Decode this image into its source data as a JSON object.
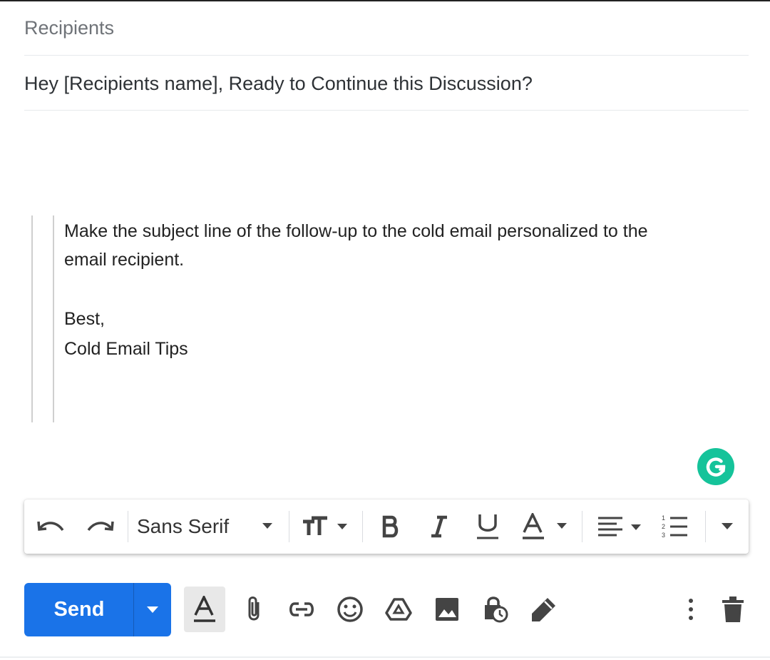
{
  "compose": {
    "recipients_label": "Recipients",
    "subject": "Hey [Recipients name], Ready to Continue this Discussion?",
    "body_line1": "Make the subject line of the follow-up to the cold email personalized to the",
    "body_line2": "email recipient.",
    "signoff": "Best,",
    "signature": "Cold Email Tips"
  },
  "format_toolbar": {
    "font_name": "Sans Serif",
    "icons": [
      "undo-icon",
      "redo-icon",
      "text-size-icon",
      "bold-icon",
      "italic-icon",
      "underline-icon",
      "text-color-icon",
      "align-icon",
      "numbered-list-icon",
      "more-formatting-icon"
    ]
  },
  "bottom_toolbar": {
    "send_label": "Send",
    "icons": [
      "formatting-options-icon",
      "attach-icon",
      "link-icon",
      "emoji-icon",
      "drive-icon",
      "photo-icon",
      "confidential-mode-icon",
      "signature-icon",
      "more-options-icon",
      "delete-icon"
    ]
  },
  "colors": {
    "send_blue": "#1a73e8",
    "grammarly_green": "#15c39a",
    "icon_gray": "#444444"
  }
}
